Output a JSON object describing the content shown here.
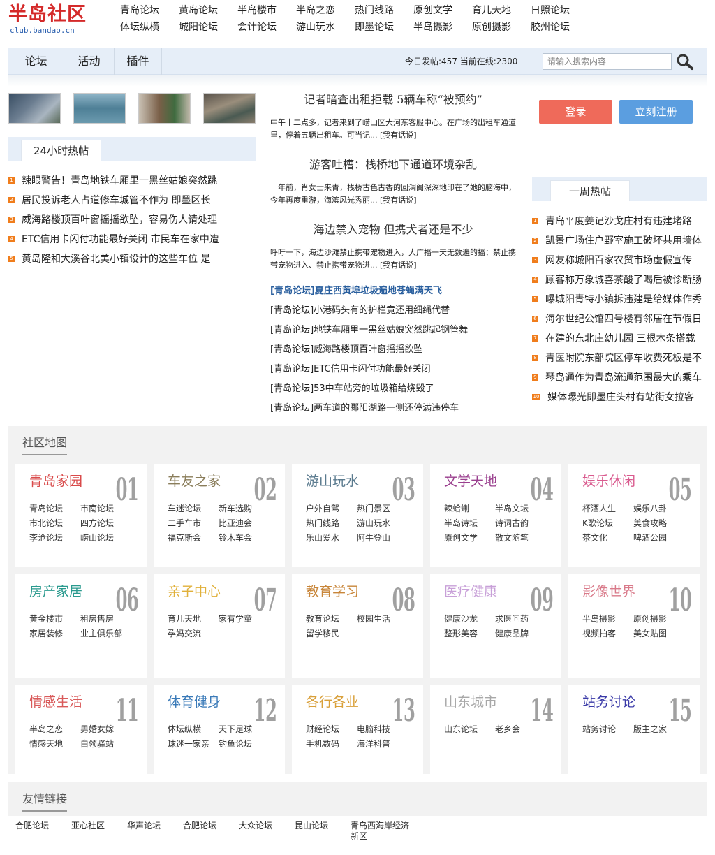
{
  "logo": {
    "main": "半岛社区",
    "sub": "club.bandao.cn"
  },
  "topnav": [
    "青岛论坛",
    "黄岛论坛",
    "半岛楼市",
    "半岛之恋",
    "热门线路",
    "原创文学",
    "育儿天地",
    "日照论坛",
    "体坛纵横",
    "城阳论坛",
    "会计论坛",
    "游山玩水",
    "即墨论坛",
    "半岛摄影",
    "原创摄影",
    "胶州论坛"
  ],
  "navbar": {
    "tabs": [
      "论坛",
      "活动",
      "插件"
    ],
    "stats": "今日发帖:457 当前在线:2300",
    "search_placeholder": "请输入搜索内容"
  },
  "hot24": {
    "title": "24小时热帖",
    "items": [
      "辣眼警告！青岛地铁车厢里一黑丝姑娘突然跳",
      "居民投诉老人占道修车城管不作为 即墨区长",
      "威海路楼顶百叶窗摇摇欲坠，容易伤人请处理",
      "ETC信用卡闪付功能最好关闭 市民车在家中遭",
      "黄岛隆和大溪谷北美小镇设计的这些车位 是"
    ]
  },
  "news": [
    {
      "title": "记者暗查出租拒载 5辆车称“被预约”",
      "summary": "中午十二点多，记者来到了崂山区大河东客服中心。在广场的出租车通道里，停着五辆出租车。可当记... [我有话说]"
    },
    {
      "title": "游客吐槽：栈桥地下通道环境杂乱",
      "summary": "十年前，肖女士来青，栈桥古色古香的回澜阁深深地印在了她的脑海中，今年再度重游，海滨风光秀丽... [我有话说]"
    },
    {
      "title": "海边禁入宠物 但携犬者还是不少",
      "summary": "呼吁一下，海边沙滩禁止携带宠物进入，大广播一天无数遍的播：禁止携带宠物进入、禁止携带宠物进... [我有话说]"
    }
  ],
  "bracket_list": [
    "[青岛论坛]夏庄西黄埠垃圾遍地苍蝇满天飞",
    "[青岛论坛]小港码头有的护栏竟还用细绳代替",
    "[青岛论坛]地铁车厢里一黑丝姑娘突然跳起钢管舞",
    "[青岛论坛]威海路楼顶百叶窗摇摇欲坠",
    "[青岛论坛]ETC信用卡闪付功能最好关闭",
    "[青岛论坛]53中车站旁的垃圾箱给烧毁了",
    "[青岛论坛]两车道的郾阳湖路一侧还停满违停车"
  ],
  "auth": {
    "login": "登录",
    "register": "立刻注册"
  },
  "weekly": {
    "title": "一周热帖",
    "items": [
      "青岛平度姜记沙戈庄村有违建堵路",
      "凯景广场住户野室施工破坏共用墙体",
      "网友称城阳百家农贸市场虚假宣传",
      "顾客称万象城喜茶酸了喝后被诊断肠",
      "曝城阳青特小镇拆违建是给媒体作秀",
      "海尔世纪公馆四号楼有邻居在节假日",
      "在建的东北庄幼儿园 三根木条搭载",
      "青医附院东部院区停车收费死板是不",
      "琴岛通作为青岛流通范围最大的乘车",
      "媒体曝光即墨庄头村有站街女拉客"
    ]
  },
  "community_map": {
    "title": "社区地图",
    "cards": [
      {
        "num": "01",
        "title": "青岛家园",
        "color": "#d94a4a",
        "links": [
          "青岛论坛",
          "市南论坛",
          "市北论坛",
          "四方论坛",
          "李沧论坛",
          "崂山论坛"
        ]
      },
      {
        "num": "02",
        "title": "车友之家",
        "color": "#8a7d5a",
        "links": [
          "车迷论坛",
          "新车选购",
          "二手车市",
          "比亚迪会",
          "福克斯会",
          "铃木车会"
        ]
      },
      {
        "num": "03",
        "title": "游山玩水",
        "color": "#5a7a8e",
        "links": [
          "户外自驾",
          "热门景区",
          "热门线路",
          "游山玩水",
          "乐山爱水",
          "阿牛登山"
        ]
      },
      {
        "num": "04",
        "title": "文学天地",
        "color": "#9a3f8e",
        "links": [
          "辣蛤蜊",
          "半岛文坛",
          "半岛诗坛",
          "诗词古韵",
          "原创文学",
          "散文随笔"
        ]
      },
      {
        "num": "05",
        "title": "娱乐休闲",
        "color": "#d95a8e",
        "links": [
          "杯酒人生",
          "娱乐八卦",
          "K歌论坛",
          "美食攻略",
          "茶文化",
          "啤酒公园"
        ]
      },
      {
        "num": "06",
        "title": "房产家居",
        "color": "#2a9a8e",
        "links": [
          "黄金楼市",
          "租房售房",
          "家居装修",
          "业主俱乐部"
        ]
      },
      {
        "num": "07",
        "title": "亲子中心",
        "color": "#e0b03a",
        "links": [
          "育儿天地",
          "家有学童",
          "孕妈交流"
        ]
      },
      {
        "num": "08",
        "title": "教育学习",
        "color": "#c8863a",
        "links": [
          "教育论坛",
          "校园生活",
          "留学移民"
        ]
      },
      {
        "num": "09",
        "title": "医疗健康",
        "color": "#c8a0d8",
        "links": [
          "健康沙龙",
          "求医问药",
          "整形美容",
          "健康品牌"
        ]
      },
      {
        "num": "10",
        "title": "影像世界",
        "color": "#d97a8a",
        "links": [
          "半岛摄影",
          "原创摄影",
          "视频拍客",
          "美女贴图"
        ]
      },
      {
        "num": "11",
        "title": "情感生活",
        "color": "#d95a5a",
        "links": [
          "半岛之恋",
          "男婚女嫁",
          "情感天地",
          "白领驿站"
        ]
      },
      {
        "num": "12",
        "title": "体育健身",
        "color": "#3a7ab8",
        "links": [
          "体坛纵横",
          "天下足球",
          "球迷一家亲",
          "钓鱼论坛"
        ]
      },
      {
        "num": "13",
        "title": "各行各业",
        "color": "#d9a03a",
        "links": [
          "财经论坛",
          "电脑科技",
          "手机数码",
          "海洋科普"
        ]
      },
      {
        "num": "14",
        "title": "山东城市",
        "color": "#a8a8a8",
        "links": [
          "山东论坛",
          "老乡会"
        ]
      },
      {
        "num": "15",
        "title": "站务讨论",
        "color": "#3a3aa8",
        "links": [
          "站务讨论",
          "版主之家"
        ]
      }
    ]
  },
  "friend_links": {
    "title": "友情链接",
    "items": [
      "合肥论坛",
      "亚心社区",
      "华声论坛",
      "合肥论坛",
      "大众论坛",
      "昆山论坛",
      "青岛西海岸经济新区"
    ]
  }
}
